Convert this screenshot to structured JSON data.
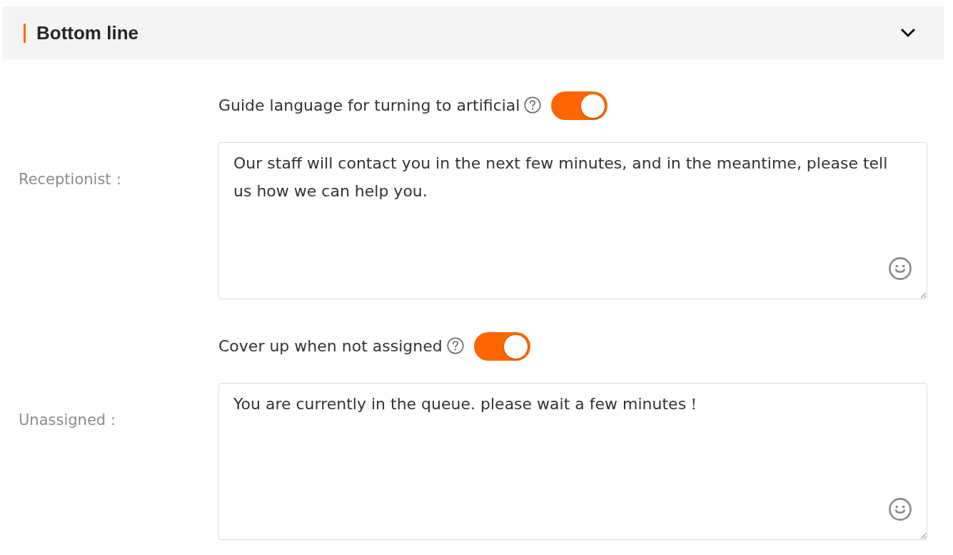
{
  "section": {
    "title": "Bottom line",
    "expanded": true
  },
  "fields": [
    {
      "label": "Receptionist：",
      "toggle": {
        "label": "Guide language for turning to artificial",
        "on": true
      },
      "value": "Our staff will contact you in the next few minutes, and in the meantime, please tell us how we can help you."
    },
    {
      "label": "Unassigned：",
      "toggle": {
        "label": "Cover up when not assigned",
        "on": true
      },
      "value": "You are currently in the queue. please wait a few minutes！"
    }
  ]
}
